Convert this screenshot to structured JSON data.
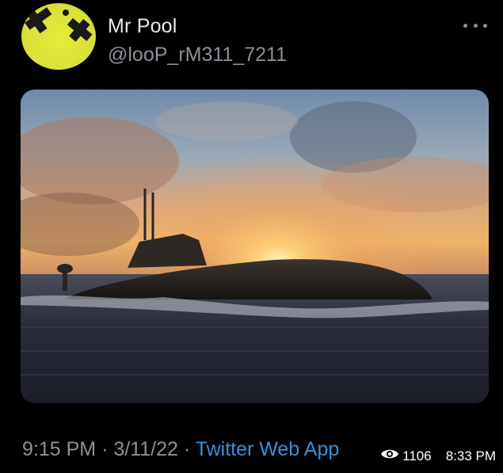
{
  "tweet": {
    "display_name": "Mr Pool",
    "handle": "@looP_rM311_7211",
    "media_alt": "submarine-at-sunset",
    "timestamp": {
      "time": "9:15 PM",
      "separator": "·",
      "date": "3/11/22",
      "separator2": "·",
      "source": "Twitter Web App"
    }
  },
  "overlay": {
    "views_icon": "eye-icon",
    "views": "1106",
    "post_time": "8:33 PM"
  },
  "colors": {
    "background": "#000000",
    "name_text": "#e7e9ea",
    "secondary_text": "#8b9197",
    "link": "#3b8fd6",
    "avatar_yellow": "#dce23a"
  }
}
